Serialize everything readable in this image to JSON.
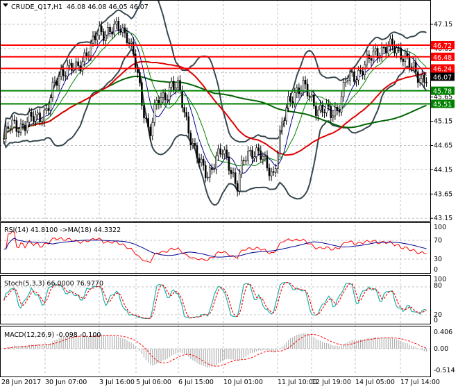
{
  "header": {
    "symbol": "CRUDE_Q17,H1",
    "ohlc": "46.08 46.08 46.05 46.07"
  },
  "chart_data": {
    "type": "candlestick",
    "title": "CRUDE_Q17,H1",
    "price_ticks": [
      47.15,
      46.65,
      46.15,
      45.65,
      45.15,
      44.65,
      44.15,
      43.65,
      43.15
    ],
    "ylim": [
      43.15,
      47.15
    ],
    "x_labels": [
      "28 Jun 2017",
      "30 Jun 07:00",
      "3 Jul 16:00",
      "5 Jul 06:00",
      "6 Jul 15:00",
      "10 Jul 01:00",
      "11 Jul 10:00",
      "12 Jul 19:00",
      "14 Jul 05:00",
      "17 Jul 14:00"
    ],
    "closes_sampled": [
      44.79,
      45.07,
      45.07,
      45.07,
      45.22,
      45.29,
      45.36,
      45.93,
      46.22,
      46.22,
      46.22,
      46.51,
      46.65,
      47.01,
      47.01,
      47.01,
      47.08,
      46.94,
      46.36,
      45.5,
      44.93,
      45.5,
      45.65,
      45.93,
      45.79,
      45.22,
      44.64,
      44.21,
      44.07,
      44.36,
      44.5,
      44.28,
      43.78,
      44.36,
      44.57,
      44.5,
      44.21,
      44.07,
      44.93,
      45.5,
      45.79,
      45.86,
      45.65,
      45.43,
      45.36,
      45.29,
      45.5,
      46.0,
      46.07,
      46.22,
      46.36,
      46.58,
      46.65,
      46.65,
      46.65,
      46.51,
      46.22,
      46.07,
      46.07
    ],
    "current_price": {
      "value": "46.07",
      "color": "#000000"
    },
    "levels": [
      {
        "value": "46.72",
        "color": "#ff0000"
      },
      {
        "value": "46.48",
        "color": "#ff0000"
      },
      {
        "value": "46.24",
        "color": "#ff0000"
      },
      {
        "value": "45.78",
        "color": "#008000"
      },
      {
        "value": "45.51",
        "color": "#008000"
      }
    ],
    "rsi": {
      "label": "RSI(14) 41.8100  ->MA(18) 44.3322",
      "ticks": [
        "100",
        "70",
        "30",
        "0"
      ],
      "value": 41.81,
      "ma": 44.3322
    },
    "stoch": {
      "label": "Stoch(5,3,3) 66.0000 76.9770",
      "ticks": [
        "100",
        "80",
        "20",
        "0"
      ],
      "main": 66.0,
      "signal": 76.977
    },
    "macd": {
      "label": "MACD(12,26,9) -0.098 -0.100",
      "ticks": [
        "0.406",
        "0.00",
        "-0.514"
      ],
      "main": -0.098,
      "signal": -0.1
    }
  }
}
